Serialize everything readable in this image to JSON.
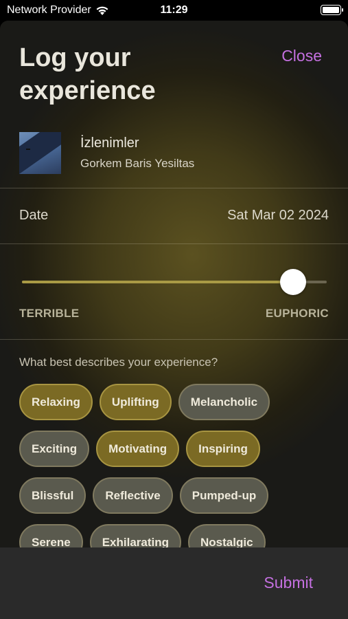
{
  "status_bar": {
    "carrier": "Network Provider",
    "time": "11:29"
  },
  "header": {
    "title": "Log your experience",
    "close_label": "Close"
  },
  "track": {
    "title": "İzlenimler",
    "artist": "Gorkem Baris Yesiltas"
  },
  "date": {
    "label": "Date",
    "value": "Sat Mar 02 2024"
  },
  "rating": {
    "min_label": "TERRIBLE",
    "max_label": "EUPHORIC",
    "value": 0.89
  },
  "descriptors": {
    "question": "What best describes your experience?",
    "rows": [
      [
        {
          "label": "Relaxing",
          "selected": true
        },
        {
          "label": "Uplifting",
          "selected": true
        },
        {
          "label": "Melancholic",
          "selected": false
        }
      ],
      [
        {
          "label": "Exciting",
          "selected": false
        },
        {
          "label": "Motivating",
          "selected": true
        },
        {
          "label": "Inspiring",
          "selected": true
        }
      ],
      [
        {
          "label": "Blissful",
          "selected": false
        },
        {
          "label": "Reflective",
          "selected": false
        },
        {
          "label": "Pumped-up",
          "selected": false
        }
      ],
      [
        {
          "label": "Serene",
          "selected": false
        },
        {
          "label": "Exhilarating",
          "selected": false
        },
        {
          "label": "Nostalgic",
          "selected": false
        }
      ]
    ]
  },
  "footer": {
    "submit_label": "Submit"
  },
  "colors": {
    "accent": "#c470e0",
    "tag_selected": "#7b6a24",
    "tag_unselected": "#5a5a4e"
  },
  "icons": [
    "wifi-icon",
    "battery-icon"
  ]
}
